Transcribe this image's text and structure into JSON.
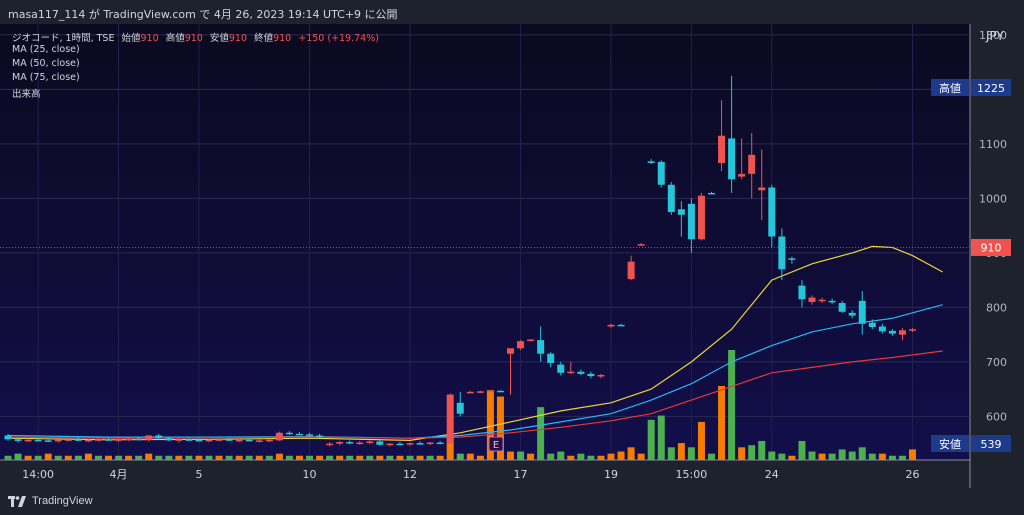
{
  "header": {
    "text": "masa117_114 が TradingView.com で 4月 26, 2023 19:14 UTC+9 に公開"
  },
  "legend": {
    "symbol": "ジオコード, 1時間, TSE",
    "ohlc": [
      {
        "label": "始値",
        "value": "910"
      },
      {
        "label": "高値",
        "value": "910"
      },
      {
        "label": "安値",
        "value": "910"
      },
      {
        "label": "終値",
        "value": "910"
      }
    ],
    "change": "+150 (+19.74%)",
    "indicators": [
      "MA (25, close)",
      "MA (50, close)",
      "MA (75, close)",
      "出来高"
    ]
  },
  "price_axis": {
    "currency": "JPY",
    "ticks": [
      "1300",
      "1200",
      "1100",
      "1000",
      "900",
      "800",
      "700",
      "600"
    ],
    "high_label": "高値",
    "high_value": "1225",
    "current_value": "910",
    "low_label": "安値",
    "low_value": "539"
  },
  "time_axis": {
    "labels": [
      "14:00",
      "4月",
      "5",
      "10",
      "12",
      "17",
      "19",
      "15:00",
      "24",
      "26"
    ]
  },
  "event_marker": "E",
  "footer": {
    "brand": "TradingView"
  },
  "colors": {
    "background": "#0d0b2e",
    "up": "#ef5350",
    "down": "#26c6da",
    "volume_up": "#f57c00",
    "volume_down": "#4caf50",
    "ma25": "#f0d23a",
    "ma50": "#29b6f6",
    "ma75": "#e53935"
  },
  "chart_data": {
    "type": "candlestick",
    "ylim": [
      520,
      1320
    ],
    "x": [
      0,
      1,
      2,
      3,
      4,
      5,
      6,
      7,
      8,
      9,
      10,
      11,
      12,
      13,
      14,
      15,
      16,
      17,
      18,
      19,
      20,
      21,
      22,
      23,
      24,
      25,
      26,
      27,
      28,
      29,
      30,
      31,
      32,
      33,
      34,
      35,
      36,
      37,
      38,
      39,
      40,
      41,
      42,
      43,
      44,
      45,
      46,
      47,
      48,
      49,
      50,
      51,
      52,
      53,
      54,
      55,
      56,
      57,
      58,
      59,
      60,
      61,
      62,
      63,
      64,
      65,
      66,
      67,
      68,
      69,
      70,
      71,
      72,
      73,
      74,
      75,
      76,
      77,
      78,
      79,
      80,
      81,
      82,
      83,
      84,
      85,
      86,
      87,
      88,
      89
    ],
    "x_tick_labels": [
      {
        "x": 3,
        "label": "14:00"
      },
      {
        "x": 11,
        "label": "4月"
      },
      {
        "x": 19,
        "label": "5"
      },
      {
        "x": 30,
        "label": "10"
      },
      {
        "x": 40,
        "label": "12"
      },
      {
        "x": 51,
        "label": "17"
      },
      {
        "x": 60,
        "label": "19"
      },
      {
        "x": 68,
        "label": "15:00"
      },
      {
        "x": 76,
        "label": "24"
      },
      {
        "x": 90,
        "label": "26"
      }
    ],
    "candles": [
      [
        0,
        565,
        568,
        555,
        558
      ],
      [
        1,
        558,
        562,
        552,
        555
      ],
      [
        2,
        556,
        560,
        553,
        557
      ],
      [
        3,
        557,
        560,
        554,
        556
      ],
      [
        4,
        556,
        559,
        553,
        555
      ],
      [
        5,
        555,
        558,
        552,
        557
      ],
      [
        6,
        557,
        561,
        554,
        558
      ],
      [
        7,
        558,
        562,
        555,
        556
      ],
      [
        8,
        556,
        559,
        553,
        557
      ],
      [
        9,
        557,
        560,
        554,
        558
      ],
      [
        10,
        558,
        561,
        555,
        556
      ],
      [
        11,
        556,
        560,
        553,
        558
      ],
      [
        12,
        558,
        562,
        555,
        559
      ],
      [
        13,
        559,
        563,
        556,
        557
      ],
      [
        14,
        557,
        566,
        554,
        565
      ],
      [
        15,
        565,
        568,
        557,
        560
      ],
      [
        16,
        560,
        563,
        555,
        556
      ],
      [
        17,
        556,
        560,
        552,
        558
      ],
      [
        18,
        558,
        561,
        555,
        557
      ],
      [
        19,
        557,
        560,
        554,
        556
      ],
      [
        20,
        556,
        559,
        553,
        557
      ],
      [
        21,
        557,
        560,
        554,
        558
      ],
      [
        22,
        558,
        561,
        555,
        556
      ],
      [
        23,
        556,
        560,
        553,
        557
      ],
      [
        24,
        557,
        560,
        554,
        555
      ],
      [
        25,
        555,
        558,
        552,
        556
      ],
      [
        26,
        556,
        559,
        553,
        557
      ],
      [
        27,
        556,
        572,
        555,
        570
      ],
      [
        28,
        570,
        573,
        566,
        568
      ],
      [
        29,
        568,
        571,
        565,
        567
      ],
      [
        30,
        567,
        570,
        563,
        565
      ],
      [
        31,
        565,
        568,
        560,
        562
      ],
      [
        32,
        548,
        553,
        545,
        550
      ],
      [
        33,
        550,
        555,
        547,
        553
      ],
      [
        34,
        553,
        556,
        549,
        551
      ],
      [
        35,
        551,
        555,
        548,
        552
      ],
      [
        36,
        552,
        556,
        549,
        554
      ],
      [
        37,
        554,
        557,
        546,
        548
      ],
      [
        38,
        548,
        551,
        545,
        550
      ],
      [
        39,
        550,
        553,
        547,
        549
      ],
      [
        40,
        549,
        552,
        546,
        551
      ],
      [
        41,
        551,
        554,
        548,
        550
      ],
      [
        42,
        550,
        553,
        547,
        552
      ],
      [
        43,
        552,
        555,
        549,
        551
      ],
      [
        44,
        551,
        642,
        550,
        640
      ],
      [
        45,
        625,
        645,
        600,
        605
      ],
      [
        46,
        645,
        647,
        643,
        645
      ],
      [
        47,
        645,
        647,
        643,
        646
      ],
      [
        48,
        646,
        648,
        645,
        647
      ],
      [
        49,
        647,
        648,
        645,
        646
      ],
      [
        50,
        715,
        720,
        640,
        725
      ],
      [
        51,
        725,
        740,
        722,
        738
      ],
      [
        52,
        740,
        742,
        738,
        741
      ],
      [
        53,
        740,
        765,
        700,
        715
      ],
      [
        54,
        715,
        718,
        690,
        698
      ],
      [
        55,
        695,
        700,
        675,
        680
      ],
      [
        56,
        680,
        700,
        678,
        682
      ],
      [
        57,
        682,
        686,
        676,
        678
      ],
      [
        58,
        678,
        682,
        670,
        674
      ],
      [
        59,
        675,
        678,
        670,
        676
      ],
      [
        60,
        765,
        770,
        763,
        768
      ],
      [
        61,
        768,
        770,
        766,
        767
      ],
      [
        62,
        852,
        895,
        850,
        884
      ],
      [
        63,
        915,
        918,
        913,
        916
      ],
      [
        64,
        1068,
        1072,
        1063,
        1065
      ],
      [
        65,
        1067,
        1070,
        1020,
        1025
      ],
      [
        66,
        1025,
        1030,
        970,
        975
      ],
      [
        67,
        980,
        995,
        930,
        970
      ],
      [
        68,
        990,
        1000,
        900,
        925
      ],
      [
        69,
        925,
        1010,
        923,
        1005
      ],
      [
        70,
        1010,
        1012,
        1008,
        1009
      ],
      [
        71,
        1065,
        1180,
        1050,
        1115
      ],
      [
        72,
        1110,
        1225,
        1010,
        1035
      ],
      [
        73,
        1040,
        1110,
        1035,
        1045
      ],
      [
        74,
        1045,
        1120,
        1000,
        1080
      ],
      [
        75,
        1015,
        1090,
        960,
        1020
      ],
      [
        76,
        1020,
        1025,
        910,
        930
      ],
      [
        77,
        930,
        945,
        850,
        870
      ],
      [
        78,
        890,
        893,
        880,
        888
      ],
      [
        79,
        840,
        850,
        800,
        815
      ],
      [
        80,
        810,
        822,
        805,
        818
      ],
      [
        81,
        812,
        818,
        808,
        814
      ],
      [
        82,
        812,
        816,
        806,
        810
      ],
      [
        83,
        808,
        812,
        790,
        792
      ],
      [
        84,
        790,
        795,
        780,
        785
      ],
      [
        85,
        812,
        830,
        750,
        770
      ],
      [
        86,
        772,
        778,
        760,
        764
      ],
      [
        87,
        765,
        770,
        752,
        756
      ],
      [
        88,
        757,
        760,
        748,
        752
      ],
      [
        89,
        750,
        762,
        740,
        758
      ],
      [
        90,
        758,
        762,
        755,
        760
      ]
    ],
    "volume": [
      [
        0,
        2,
        0
      ],
      [
        1,
        3,
        0
      ],
      [
        2,
        2,
        1
      ],
      [
        3,
        2,
        0
      ],
      [
        4,
        3,
        1
      ],
      [
        5,
        2,
        0
      ],
      [
        6,
        2,
        1
      ],
      [
        7,
        2,
        0
      ],
      [
        8,
        3,
        1
      ],
      [
        9,
        2,
        0
      ],
      [
        10,
        2,
        1
      ],
      [
        11,
        2,
        0
      ],
      [
        12,
        2,
        1
      ],
      [
        13,
        2,
        0
      ],
      [
        14,
        3,
        1
      ],
      [
        15,
        2,
        0
      ],
      [
        16,
        2,
        0
      ],
      [
        17,
        2,
        1
      ],
      [
        18,
        2,
        0
      ],
      [
        19,
        2,
        1
      ],
      [
        20,
        2,
        0
      ],
      [
        21,
        2,
        1
      ],
      [
        22,
        2,
        0
      ],
      [
        23,
        2,
        1
      ],
      [
        24,
        2,
        0
      ],
      [
        25,
        2,
        1
      ],
      [
        26,
        2,
        0
      ],
      [
        27,
        3,
        1
      ],
      [
        28,
        2,
        0
      ],
      [
        29,
        2,
        1
      ],
      [
        30,
        2,
        0
      ],
      [
        31,
        2,
        1
      ],
      [
        32,
        2,
        0
      ],
      [
        33,
        2,
        1
      ],
      [
        34,
        2,
        0
      ],
      [
        35,
        2,
        1
      ],
      [
        36,
        2,
        0
      ],
      [
        37,
        2,
        1
      ],
      [
        38,
        2,
        0
      ],
      [
        39,
        2,
        1
      ],
      [
        40,
        2,
        0
      ],
      [
        41,
        2,
        1
      ],
      [
        42,
        2,
        0
      ],
      [
        43,
        2,
        1
      ],
      [
        44,
        12,
        1
      ],
      [
        45,
        3,
        0
      ],
      [
        46,
        3,
        1
      ],
      [
        47,
        2,
        1
      ],
      [
        48,
        33,
        1
      ],
      [
        49,
        30,
        1
      ],
      [
        50,
        4,
        1
      ],
      [
        51,
        4,
        0
      ],
      [
        52,
        3,
        1
      ],
      [
        53,
        25,
        0
      ],
      [
        54,
        3,
        0
      ],
      [
        55,
        4,
        0
      ],
      [
        56,
        2,
        1
      ],
      [
        57,
        3,
        0
      ],
      [
        58,
        2,
        0
      ],
      [
        59,
        2,
        1
      ],
      [
        60,
        3,
        1
      ],
      [
        61,
        4,
        1
      ],
      [
        62,
        6,
        1
      ],
      [
        63,
        3,
        1
      ],
      [
        64,
        19,
        0
      ],
      [
        65,
        21,
        0
      ],
      [
        66,
        6,
        0
      ],
      [
        67,
        8,
        1
      ],
      [
        68,
        6,
        0
      ],
      [
        69,
        18,
        1
      ],
      [
        70,
        3,
        0
      ],
      [
        71,
        35,
        1
      ],
      [
        72,
        52,
        0
      ],
      [
        73,
        6,
        1
      ],
      [
        74,
        7,
        0
      ],
      [
        75,
        9,
        0
      ],
      [
        76,
        4,
        0
      ],
      [
        77,
        3,
        0
      ],
      [
        78,
        2,
        1
      ],
      [
        79,
        9,
        0
      ],
      [
        80,
        4,
        0
      ],
      [
        81,
        3,
        1
      ],
      [
        82,
        3,
        0
      ],
      [
        83,
        5,
        0
      ],
      [
        84,
        4,
        0
      ],
      [
        85,
        6,
        0
      ],
      [
        86,
        3,
        0
      ],
      [
        87,
        3,
        1
      ],
      [
        88,
        2,
        0
      ],
      [
        89,
        2,
        0
      ],
      [
        90,
        5,
        1
      ]
    ],
    "ma25": [
      [
        0,
        560
      ],
      [
        10,
        557
      ],
      [
        20,
        558
      ],
      [
        30,
        560
      ],
      [
        40,
        556
      ],
      [
        45,
        570
      ],
      [
        50,
        590
      ],
      [
        55,
        610
      ],
      [
        60,
        625
      ],
      [
        64,
        650
      ],
      [
        68,
        700
      ],
      [
        72,
        760
      ],
      [
        76,
        850
      ],
      [
        80,
        880
      ],
      [
        84,
        900
      ],
      [
        86,
        912
      ],
      [
        88,
        910
      ],
      [
        90,
        895
      ],
      [
        93,
        865
      ]
    ],
    "ma50": [
      [
        0,
        565
      ],
      [
        10,
        562
      ],
      [
        20,
        562
      ],
      [
        30,
        563
      ],
      [
        40,
        560
      ],
      [
        45,
        565
      ],
      [
        50,
        575
      ],
      [
        55,
        590
      ],
      [
        60,
        605
      ],
      [
        64,
        630
      ],
      [
        68,
        660
      ],
      [
        72,
        700
      ],
      [
        76,
        730
      ],
      [
        80,
        755
      ],
      [
        84,
        770
      ],
      [
        88,
        780
      ],
      [
        93,
        805
      ]
    ],
    "ma75": [
      [
        0,
        562
      ],
      [
        10,
        560
      ],
      [
        20,
        561
      ],
      [
        30,
        562
      ],
      [
        40,
        560
      ],
      [
        45,
        562
      ],
      [
        50,
        570
      ],
      [
        55,
        580
      ],
      [
        60,
        592
      ],
      [
        64,
        605
      ],
      [
        68,
        630
      ],
      [
        72,
        655
      ],
      [
        76,
        680
      ],
      [
        80,
        690
      ],
      [
        84,
        700
      ],
      [
        88,
        708
      ],
      [
        93,
        720
      ]
    ]
  }
}
